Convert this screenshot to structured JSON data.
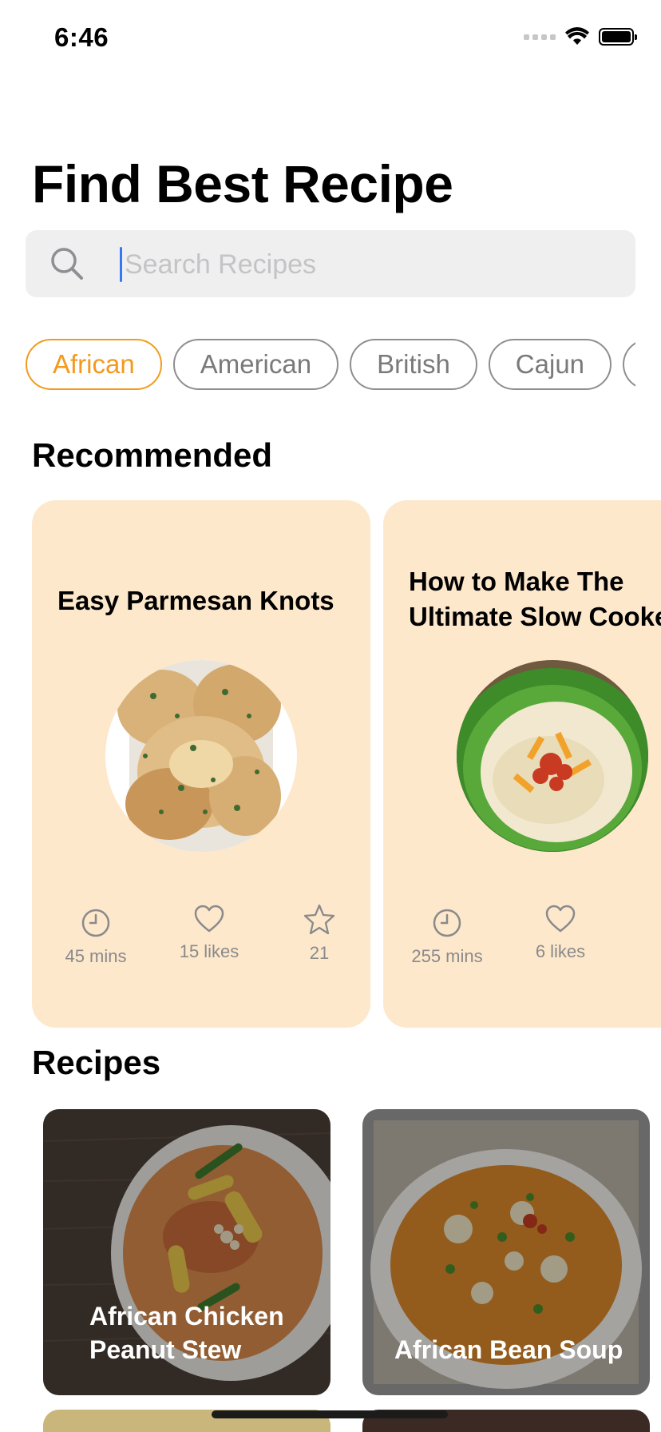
{
  "status_bar": {
    "time": "6:46",
    "battery_level": 1.0
  },
  "header": {
    "title": "Find Best Recipe"
  },
  "search": {
    "placeholder": "Search Recipes",
    "value": ""
  },
  "categories": {
    "selected": "African",
    "items": [
      "African",
      "American",
      "British",
      "Cajun"
    ]
  },
  "recommended": {
    "section_title": "Recommended",
    "cards": [
      {
        "title_lines": [
          "Easy Parmesan Knots"
        ],
        "time": "45 mins",
        "likes": "15 likes",
        "rating": "21"
      },
      {
        "title_lines": [
          "How to Make The",
          "Ultimate Slow Cooke"
        ],
        "time": "255 mins",
        "likes": "6 likes",
        "rating": ""
      }
    ]
  },
  "recipes": {
    "section_title": "Recipes",
    "items": [
      {
        "name": "African Chicken Peanut Stew"
      },
      {
        "name": "African Bean Soup"
      }
    ]
  },
  "colors": {
    "accent": "#f39a1e",
    "card_background": "#fde8cc",
    "chip_border": "#8e8e8e",
    "search_background": "#efeff0",
    "stat_gray": "#8a8a8a"
  },
  "icons": [
    "wifi-icon",
    "battery-icon",
    "search-icon",
    "clock-icon",
    "heart-icon",
    "star-icon"
  ]
}
